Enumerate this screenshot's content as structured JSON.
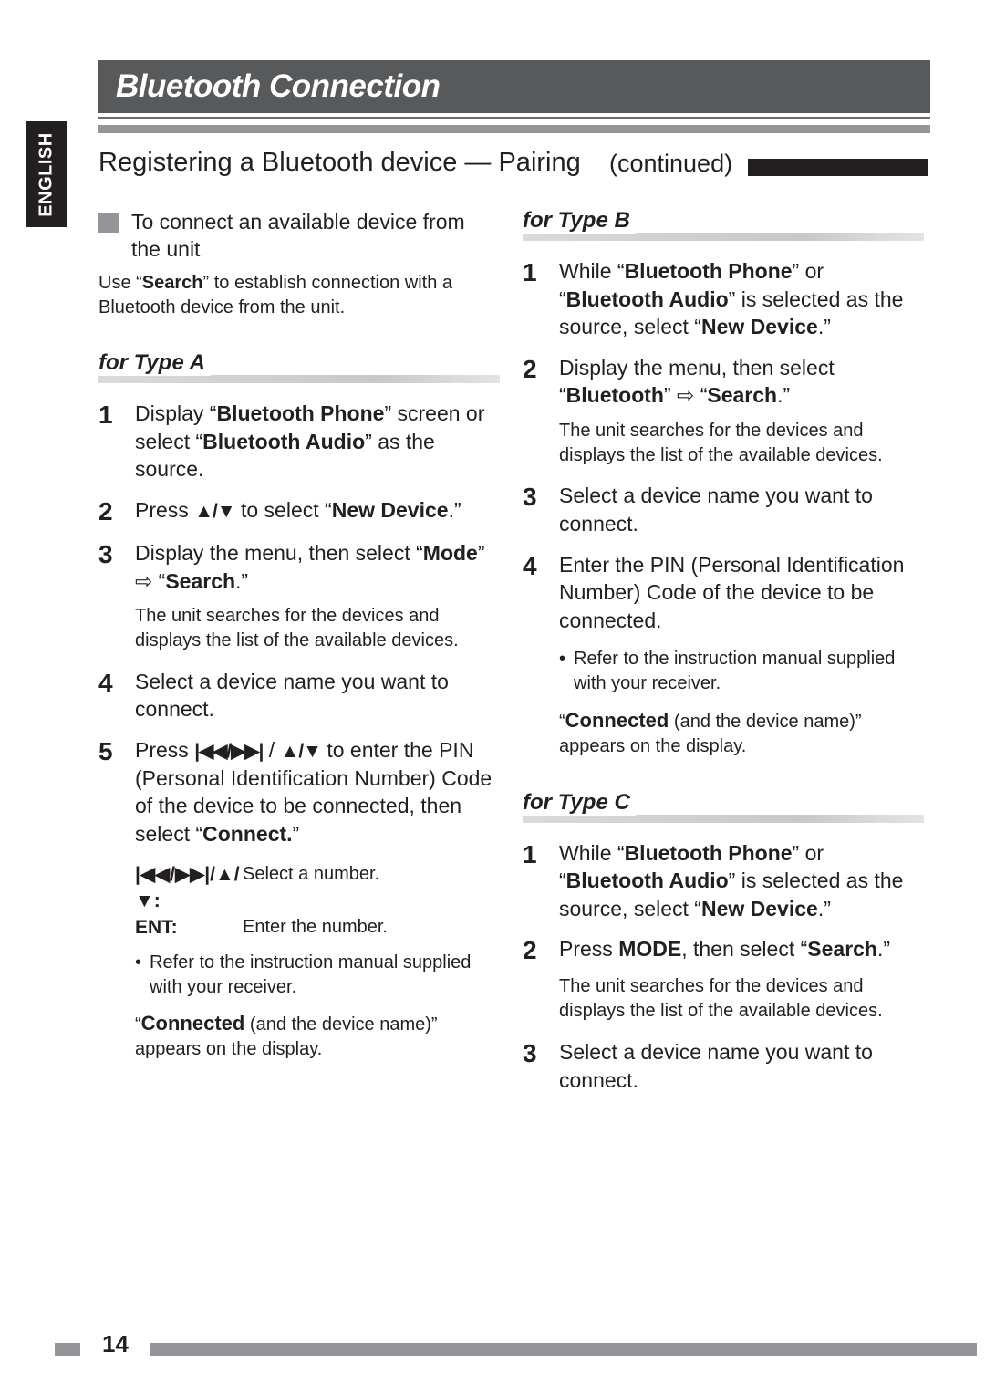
{
  "sidebar": {
    "language_tab": "ENGLISH"
  },
  "header": {
    "chapter_title": "Bluetooth Connection",
    "section_title": "Registering a Bluetooth device — Pairing",
    "continued_label": "(continued)"
  },
  "left_column": {
    "subsection": {
      "title": "To connect an available device from the unit",
      "intro_prefix": "Use “",
      "intro_bold": "Search",
      "intro_suffix": "” to establish connection with a Bluetooth device from the unit."
    },
    "type_a": {
      "label": "for Type A",
      "steps": [
        {
          "number": "1",
          "parts": [
            {
              "t": "Display “",
              "b": false
            },
            {
              "t": "Bluetooth Phone",
              "b": true
            },
            {
              "t": "” screen or select “",
              "b": false
            },
            {
              "t": "Bluetooth Audio",
              "b": true
            },
            {
              "t": "” as the source.",
              "b": false
            }
          ]
        },
        {
          "number": "2",
          "parts": [
            {
              "t": "Press ",
              "b": false
            },
            {
              "t": "▲/▼",
              "b": true
            },
            {
              "t": " to select “",
              "b": false
            },
            {
              "t": "New Device",
              "b": true
            },
            {
              "t": ".”",
              "b": false
            }
          ]
        },
        {
          "number": "3",
          "parts": [
            {
              "t": "Display the menu, then select “",
              "b": false
            },
            {
              "t": "Mode",
              "b": true
            },
            {
              "t": "” ⇨ “",
              "b": false
            },
            {
              "t": "Search",
              "b": true
            },
            {
              "t": ".”",
              "b": false
            }
          ],
          "note": "The unit searches for the devices and displays the list of the available devices."
        },
        {
          "number": "4",
          "parts": [
            {
              "t": "Select a device name you want to connect.",
              "b": false
            }
          ]
        },
        {
          "number": "5",
          "parts": [
            {
              "t": "Press ",
              "b": false
            },
            {
              "t": "|◀◀/▶▶|",
              "b": true
            },
            {
              "t": " / ",
              "b": false
            },
            {
              "t": "▲/▼",
              "b": true
            },
            {
              "t": " to enter the PIN (Personal Identification Number) Code of the device to be connected, then select “",
              "b": false
            },
            {
              "t": "Connect.",
              "b": true
            },
            {
              "t": "”",
              "b": false
            }
          ]
        }
      ],
      "key_legend": [
        {
          "key": "|◀◀/▶▶|/▲/▼:",
          "value": "Select a number."
        },
        {
          "key": "ENT:",
          "value": "Enter the number."
        }
      ],
      "bullets": [
        "Refer to the instruction manual supplied with your receiver."
      ],
      "result": {
        "open_quote": "“",
        "bold": "Connected",
        "rest": " (and the device name)” appears on the display."
      }
    }
  },
  "right_column": {
    "type_b": {
      "label": "for Type B",
      "steps": [
        {
          "number": "1",
          "parts": [
            {
              "t": "While “",
              "b": false
            },
            {
              "t": "Bluetooth Phone",
              "b": true
            },
            {
              "t": "” or “",
              "b": false
            },
            {
              "t": "Bluetooth Audio",
              "b": true
            },
            {
              "t": "” is selected as the source, select “",
              "b": false
            },
            {
              "t": "New Device",
              "b": true
            },
            {
              "t": ".”",
              "b": false
            }
          ]
        },
        {
          "number": "2",
          "parts": [
            {
              "t": "Display the menu, then select “",
              "b": false
            },
            {
              "t": "Bluetooth",
              "b": true
            },
            {
              "t": "” ⇨ “",
              "b": false
            },
            {
              "t": "Search",
              "b": true
            },
            {
              "t": ".”",
              "b": false
            }
          ],
          "note": "The unit searches for the devices and displays the list of the available devices."
        },
        {
          "number": "3",
          "parts": [
            {
              "t": "Select a device name you want to connect.",
              "b": false
            }
          ]
        },
        {
          "number": "4",
          "parts": [
            {
              "t": "Enter the PIN (Personal Identification Number) Code of the device to be connected.",
              "b": false
            }
          ]
        }
      ],
      "bullets": [
        "Refer to the instruction manual supplied with your receiver."
      ],
      "result": {
        "open_quote": "“",
        "bold": "Connected",
        "rest": " (and the device name)” appears on the display."
      }
    },
    "type_c": {
      "label": "for Type C",
      "steps": [
        {
          "number": "1",
          "parts": [
            {
              "t": "While “",
              "b": false
            },
            {
              "t": "Bluetooth Phone",
              "b": true
            },
            {
              "t": "” or “",
              "b": false
            },
            {
              "t": "Bluetooth Audio",
              "b": true
            },
            {
              "t": "” is selected as the source, select “",
              "b": false
            },
            {
              "t": "New Device",
              "b": true
            },
            {
              "t": ".”",
              "b": false
            }
          ]
        },
        {
          "number": "2",
          "parts": [
            {
              "t": "Press ",
              "b": false
            },
            {
              "t": "MODE",
              "b": true
            },
            {
              "t": ", then select “",
              "b": false
            },
            {
              "t": "Search",
              "b": true
            },
            {
              "t": ".”",
              "b": false
            }
          ],
          "note": "The unit searches for the devices and displays the list of the available devices."
        },
        {
          "number": "3",
          "parts": [
            {
              "t": "Select a device name you want to connect.",
              "b": false
            }
          ]
        }
      ]
    }
  },
  "footer": {
    "page_number": "14"
  },
  "colors": {
    "chapter_band": "#58595b",
    "rule_thick": "#939598",
    "accent_black": "#231f20",
    "type_bar": "#c7c8ca",
    "square_bullet": "#939598"
  }
}
